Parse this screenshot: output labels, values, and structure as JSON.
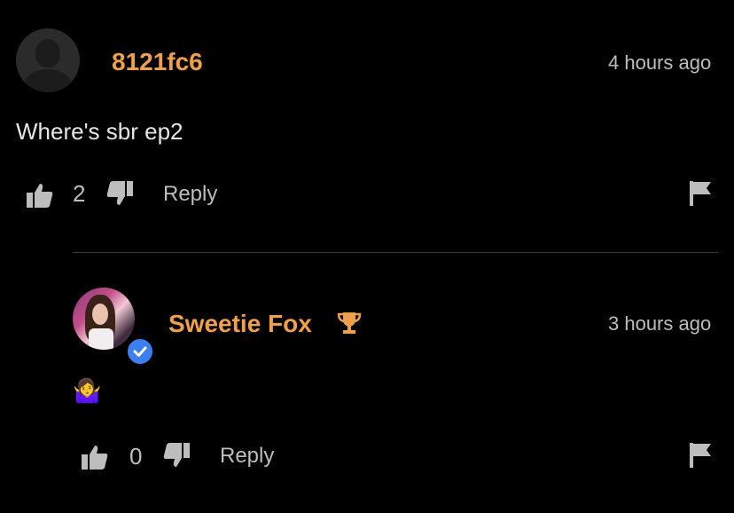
{
  "comments": [
    {
      "username": "8121fc6",
      "time": "4 hours ago",
      "text": "Where's sbr ep2",
      "likes": "2",
      "reply_label": "Reply"
    },
    {
      "username": "Sweetie Fox",
      "time": "3 hours ago",
      "text": "🤷‍♀️",
      "likes": "0",
      "reply_label": "Reply",
      "verified": true,
      "badge_icon": "trophy-icon"
    }
  ],
  "colors": {
    "username": "#f0a04a",
    "secondary_text": "#bdbdbd",
    "verified_badge": "#3d7ff0",
    "background": "#000000"
  }
}
